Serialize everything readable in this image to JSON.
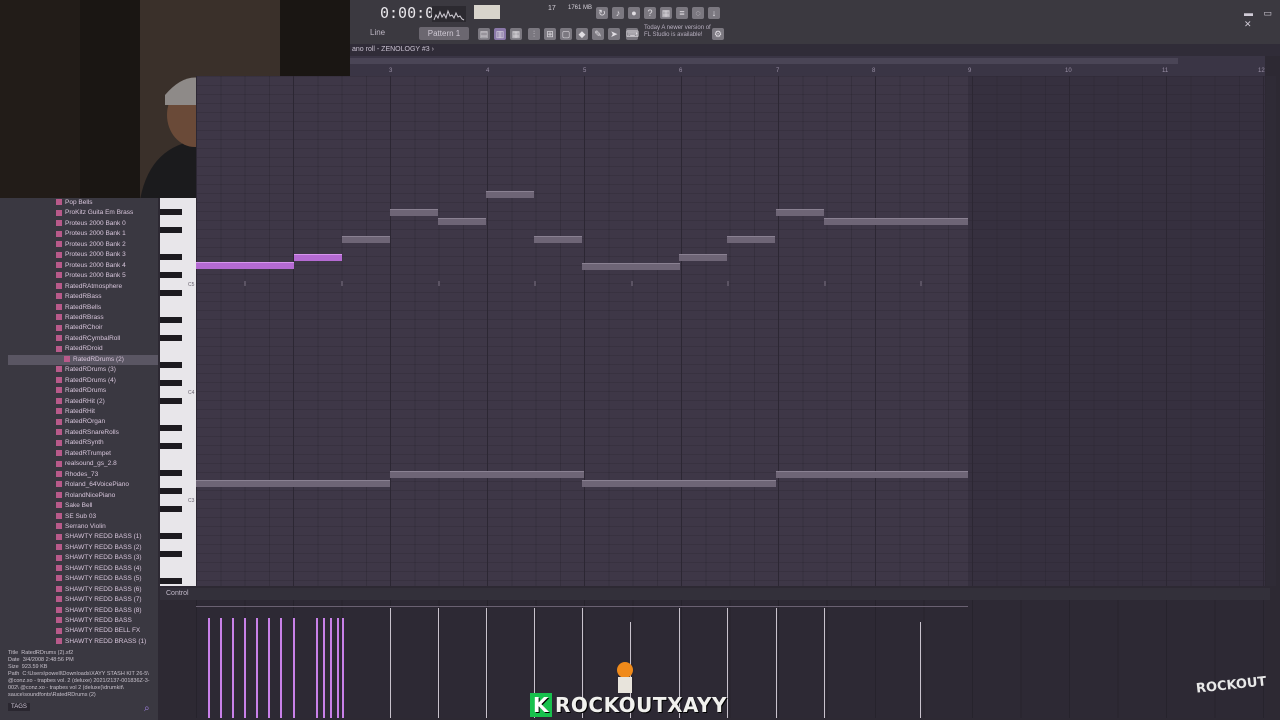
{
  "toolbar": {
    "time": "0:00:00",
    "tempo": "17",
    "cpu": "1761 MB",
    "line_mode": "Line",
    "pattern": "Pattern 1",
    "news_lines": [
      "Today  A newer version of",
      "FL Studio is available!"
    ]
  },
  "piano_roll": {
    "title": "ano roll - ZENOLOGY #3 ›",
    "ruler_numbers": [
      "3",
      "4",
      "5",
      "6",
      "7",
      "8",
      "9",
      "10",
      "11",
      "12"
    ],
    "octave_labels": [
      "C5",
      "C4",
      "C3"
    ],
    "control_label": "Control"
  },
  "browser": {
    "items": [
      "Pop Bells",
      "ProKitz Guita Em Brass",
      "Proteus 2000 Bank 0",
      "Proteus 2000 Bank 1",
      "Proteus 2000 Bank 2",
      "Proteus 2000 Bank 3",
      "Proteus 2000 Bank 4",
      "Proteus 2000 Bank 5",
      "RatedRAtmosphere",
      "RatedRBass",
      "RatedRBells",
      "RatedRBrass",
      "RatedRChoir",
      "RatedRCymbalRoll",
      "RatedRDroid",
      "RatedRDrums (2)",
      "RatedRDrums (3)",
      "RatedRDrums (4)",
      "RatedRDrums",
      "RatedRHit (2)",
      "RatedRHit",
      "RatedROrgan",
      "RatedRSnareRolls",
      "RatedRSynth",
      "RatedRTrumpet",
      "realsound_gs_2.8",
      "Rhodes_73",
      "Roland_64VoicePiano",
      "RolandNicePiano",
      "Sake Bell",
      "SE Sub 03",
      "Serrano Violin",
      "SHAWTY REDD BASS (1)",
      "SHAWTY REDD BASS (2)",
      "SHAWTY REDD BASS (3)",
      "SHAWTY REDD BASS (4)",
      "SHAWTY REDD BASS (5)",
      "SHAWTY REDD BASS (6)",
      "SHAWTY REDD BASS (7)",
      "SHAWTY REDD BASS (8)",
      "SHAWTY REDD BASS",
      "SHAWTY REDD BELL FX",
      "SHAWTY REDD BRASS (1)"
    ],
    "selected_index": 15,
    "info": {
      "title_label": "Title",
      "title": "RatedRDrums (2).sf2",
      "date_label": "Date",
      "date": "3/4/2008 2:48:56 PM",
      "size_label": "Size",
      "size": "923.59 KB",
      "path_label": "Path",
      "path": "C:\\Users\\powell\\Downloads\\XAYY STASH KIT 26-5\\ @conz.xo - trapbes vol. 2 (deluxe) 2021/2137-001836Z-3-002\\ @conz.xo - trapbes vol 2 (deluxe)\\drumkit\\ sauce\\soundfonts\\RatedRDrums (2)"
    },
    "tags_label": "TAGS"
  },
  "watermark": {
    "letter": "K",
    "text": "ROCKOUTXAYY",
    "logo": "ROCKOUT"
  },
  "colors": {
    "note_gray": "#6e6576",
    "note_pink": "#b46ad2",
    "grid_bg": "#3e3747",
    "browser_icon": "#b85a8a"
  }
}
